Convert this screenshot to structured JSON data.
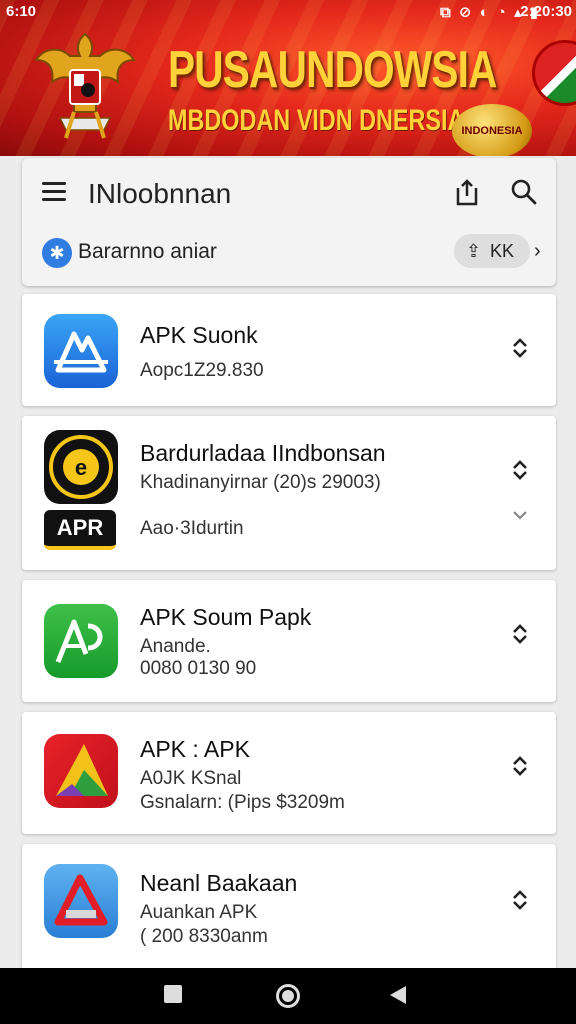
{
  "status": {
    "time": "6:10",
    "icons": "⧉ ⊘ ◐ ◔ ▴ ▮",
    "clock": "2:20:30"
  },
  "banner": {
    "title": "PUSAUNDOWSIA",
    "subtitle": "MBDODAN VIDN DNERSIA",
    "badge": "INDONESIA"
  },
  "header": {
    "title": "INloobnnan",
    "channel_label": "Bararnno aniar",
    "pill_label": "KK"
  },
  "apps": [
    {
      "name": "APK Suonk",
      "line2": "Aopc1Z29.830",
      "line3": ""
    },
    {
      "name": "Bardurladaa IIndbonsan",
      "line2": "Khadinanyirnar (20)s 29003)",
      "line3": "Aao·3Idurtin",
      "logo_text": "APR"
    },
    {
      "name": "APK Soum Papk",
      "line2": "Anande.",
      "line3": "0080 0130 90"
    },
    {
      "name": "APK : APK",
      "line2": "A0JK KSnal",
      "line3": "Gsnalarn: (Pips $3209m"
    },
    {
      "name": "Neanl Baakaan",
      "line2": "Auankan APK",
      "line3": "( 200 8330anm"
    }
  ],
  "colors": {
    "banner_red": "#d8231a",
    "banner_gold": "#ffd23a",
    "accent_blue": "#2f7de1"
  }
}
